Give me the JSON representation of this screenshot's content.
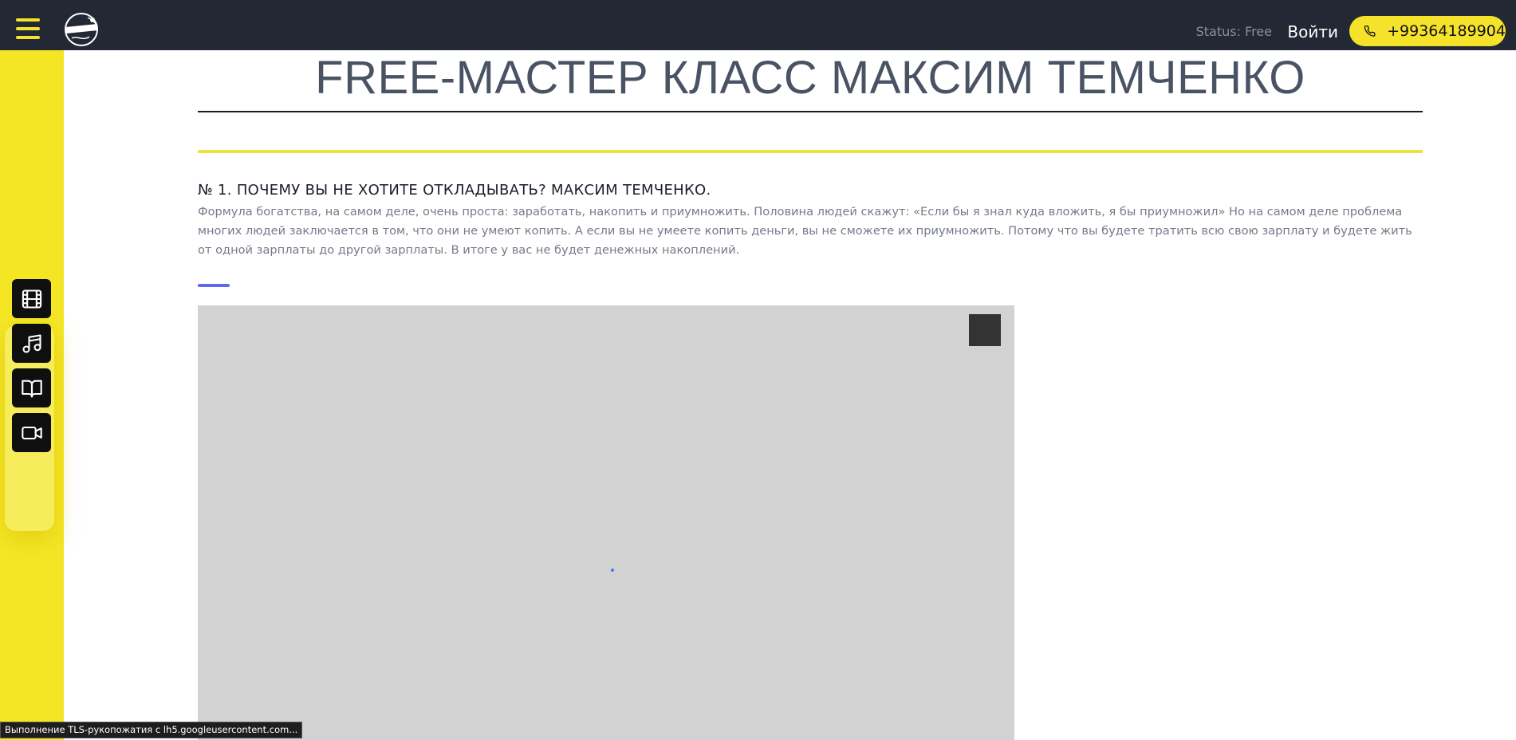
{
  "header": {
    "menu_icon": "hamburger-menu-icon",
    "logo_icon": "club-logo-icon",
    "status_text": "Status: Free",
    "login_label": "Войти",
    "phone_icon": "phone-icon",
    "phone_number": "+99364189904"
  },
  "sidebar": {
    "items": [
      {
        "icon": "film-icon"
      },
      {
        "icon": "music-note-icon"
      },
      {
        "icon": "book-icon"
      },
      {
        "icon": "video-camera-icon"
      }
    ]
  },
  "main": {
    "title": "FREE-МАСТЕР КЛАСС МАКСИМ ТЕМЧЕНКО",
    "lesson": {
      "title": "№ 1. ПОЧЕМУ ВЫ НЕ ХОТИТЕ ОТКЛАДЫВАТЬ? МАКСИМ ТЕМЧЕНКО.",
      "description": "Формула богатства, на самом деле, очень проста: заработать, накопить и приумножить. Половина людей скажут: «Если бы я знал куда вложить, я бы приумножил» Но на самом деле проблема многих людей заключается в том, что они не умеют копить. А если вы не умеете копить деньги, вы не сможете их приумножить. Потому что вы будете тратить всю свою зарплату и будете жить от одной зарплаты до другой зарплаты. В итоге у вас не будет денежных накоплений."
    }
  },
  "browser_status": "Выполнение TLS-рукопожатия с lh5.googleusercontent.com...",
  "colors": {
    "topbar": "#222834",
    "accent_yellow": "#f5e625",
    "accent_purple": "#6366f1",
    "title_gray": "#4a5363"
  }
}
